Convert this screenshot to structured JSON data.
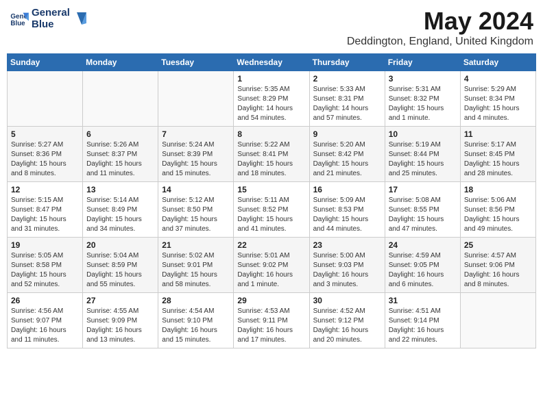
{
  "header": {
    "logo_line1": "General",
    "logo_line2": "Blue",
    "title": "May 2024",
    "subtitle": "Deddington, England, United Kingdom"
  },
  "weekdays": [
    "Sunday",
    "Monday",
    "Tuesday",
    "Wednesday",
    "Thursday",
    "Friday",
    "Saturday"
  ],
  "weeks": [
    [
      {
        "day": "",
        "info": ""
      },
      {
        "day": "",
        "info": ""
      },
      {
        "day": "",
        "info": ""
      },
      {
        "day": "1",
        "info": "Sunrise: 5:35 AM\nSunset: 8:29 PM\nDaylight: 14 hours\nand 54 minutes."
      },
      {
        "day": "2",
        "info": "Sunrise: 5:33 AM\nSunset: 8:31 PM\nDaylight: 14 hours\nand 57 minutes."
      },
      {
        "day": "3",
        "info": "Sunrise: 5:31 AM\nSunset: 8:32 PM\nDaylight: 15 hours\nand 1 minute."
      },
      {
        "day": "4",
        "info": "Sunrise: 5:29 AM\nSunset: 8:34 PM\nDaylight: 15 hours\nand 4 minutes."
      }
    ],
    [
      {
        "day": "5",
        "info": "Sunrise: 5:27 AM\nSunset: 8:36 PM\nDaylight: 15 hours\nand 8 minutes."
      },
      {
        "day": "6",
        "info": "Sunrise: 5:26 AM\nSunset: 8:37 PM\nDaylight: 15 hours\nand 11 minutes."
      },
      {
        "day": "7",
        "info": "Sunrise: 5:24 AM\nSunset: 8:39 PM\nDaylight: 15 hours\nand 15 minutes."
      },
      {
        "day": "8",
        "info": "Sunrise: 5:22 AM\nSunset: 8:41 PM\nDaylight: 15 hours\nand 18 minutes."
      },
      {
        "day": "9",
        "info": "Sunrise: 5:20 AM\nSunset: 8:42 PM\nDaylight: 15 hours\nand 21 minutes."
      },
      {
        "day": "10",
        "info": "Sunrise: 5:19 AM\nSunset: 8:44 PM\nDaylight: 15 hours\nand 25 minutes."
      },
      {
        "day": "11",
        "info": "Sunrise: 5:17 AM\nSunset: 8:45 PM\nDaylight: 15 hours\nand 28 minutes."
      }
    ],
    [
      {
        "day": "12",
        "info": "Sunrise: 5:15 AM\nSunset: 8:47 PM\nDaylight: 15 hours\nand 31 minutes."
      },
      {
        "day": "13",
        "info": "Sunrise: 5:14 AM\nSunset: 8:49 PM\nDaylight: 15 hours\nand 34 minutes."
      },
      {
        "day": "14",
        "info": "Sunrise: 5:12 AM\nSunset: 8:50 PM\nDaylight: 15 hours\nand 37 minutes."
      },
      {
        "day": "15",
        "info": "Sunrise: 5:11 AM\nSunset: 8:52 PM\nDaylight: 15 hours\nand 41 minutes."
      },
      {
        "day": "16",
        "info": "Sunrise: 5:09 AM\nSunset: 8:53 PM\nDaylight: 15 hours\nand 44 minutes."
      },
      {
        "day": "17",
        "info": "Sunrise: 5:08 AM\nSunset: 8:55 PM\nDaylight: 15 hours\nand 47 minutes."
      },
      {
        "day": "18",
        "info": "Sunrise: 5:06 AM\nSunset: 8:56 PM\nDaylight: 15 hours\nand 49 minutes."
      }
    ],
    [
      {
        "day": "19",
        "info": "Sunrise: 5:05 AM\nSunset: 8:58 PM\nDaylight: 15 hours\nand 52 minutes."
      },
      {
        "day": "20",
        "info": "Sunrise: 5:04 AM\nSunset: 8:59 PM\nDaylight: 15 hours\nand 55 minutes."
      },
      {
        "day": "21",
        "info": "Sunrise: 5:02 AM\nSunset: 9:01 PM\nDaylight: 15 hours\nand 58 minutes."
      },
      {
        "day": "22",
        "info": "Sunrise: 5:01 AM\nSunset: 9:02 PM\nDaylight: 16 hours\nand 1 minute."
      },
      {
        "day": "23",
        "info": "Sunrise: 5:00 AM\nSunset: 9:03 PM\nDaylight: 16 hours\nand 3 minutes."
      },
      {
        "day": "24",
        "info": "Sunrise: 4:59 AM\nSunset: 9:05 PM\nDaylight: 16 hours\nand 6 minutes."
      },
      {
        "day": "25",
        "info": "Sunrise: 4:57 AM\nSunset: 9:06 PM\nDaylight: 16 hours\nand 8 minutes."
      }
    ],
    [
      {
        "day": "26",
        "info": "Sunrise: 4:56 AM\nSunset: 9:07 PM\nDaylight: 16 hours\nand 11 minutes."
      },
      {
        "day": "27",
        "info": "Sunrise: 4:55 AM\nSunset: 9:09 PM\nDaylight: 16 hours\nand 13 minutes."
      },
      {
        "day": "28",
        "info": "Sunrise: 4:54 AM\nSunset: 9:10 PM\nDaylight: 16 hours\nand 15 minutes."
      },
      {
        "day": "29",
        "info": "Sunrise: 4:53 AM\nSunset: 9:11 PM\nDaylight: 16 hours\nand 17 minutes."
      },
      {
        "day": "30",
        "info": "Sunrise: 4:52 AM\nSunset: 9:12 PM\nDaylight: 16 hours\nand 20 minutes."
      },
      {
        "day": "31",
        "info": "Sunrise: 4:51 AM\nSunset: 9:14 PM\nDaylight: 16 hours\nand 22 minutes."
      },
      {
        "day": "",
        "info": ""
      }
    ]
  ]
}
